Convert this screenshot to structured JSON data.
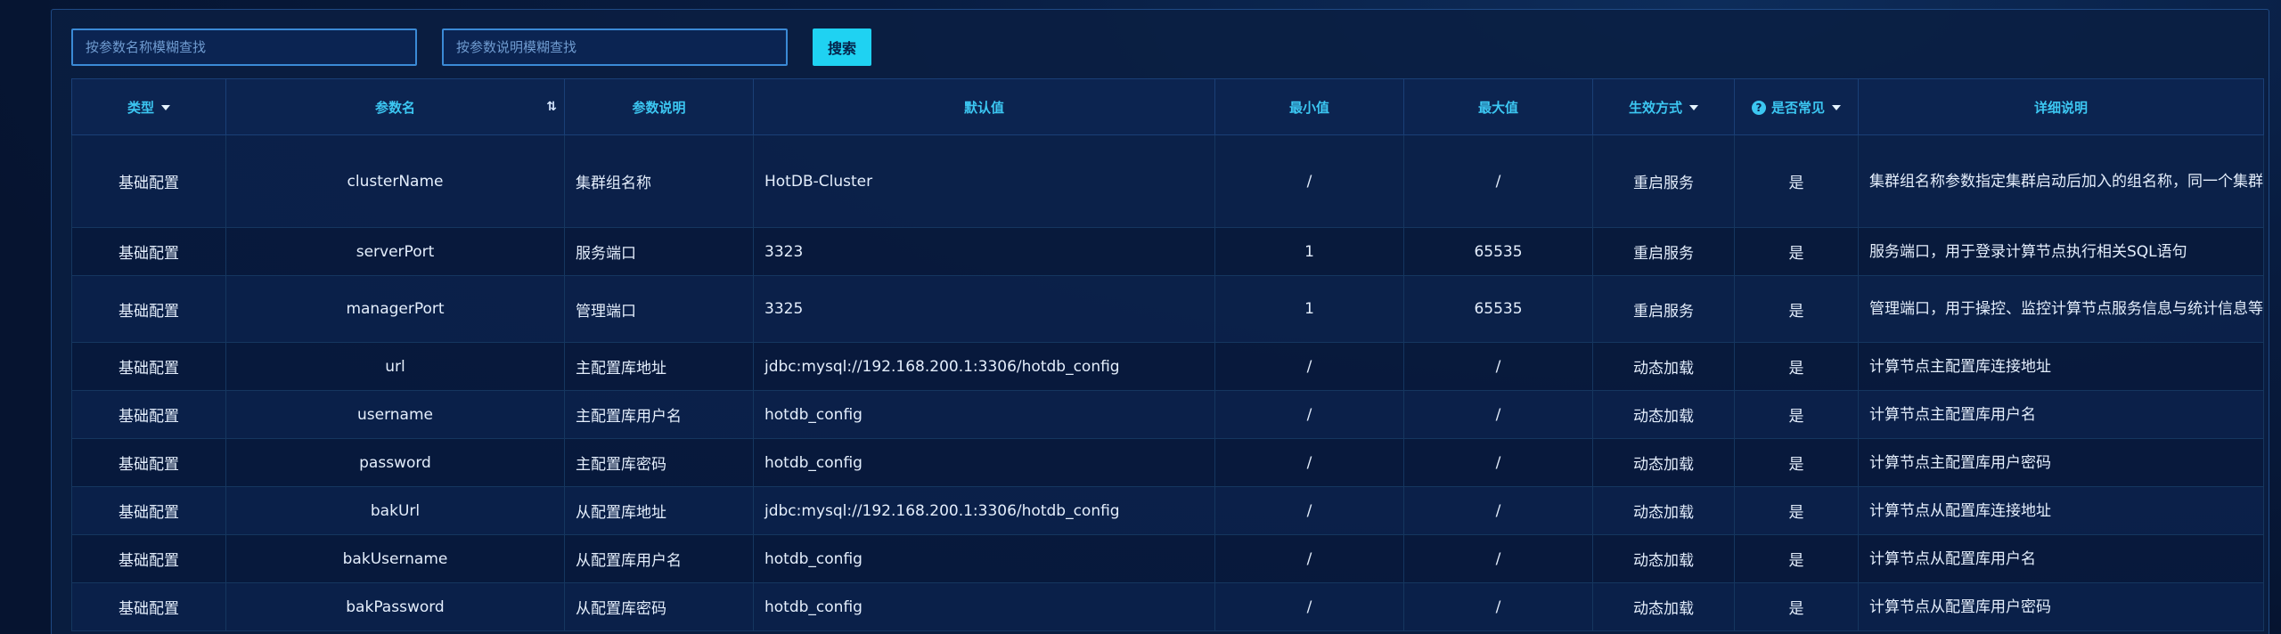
{
  "search": {
    "name_placeholder": "按参数名称模糊查找",
    "desc_placeholder": "按参数说明模糊查找",
    "button_label": "搜索"
  },
  "table": {
    "headers": {
      "type": "类型",
      "param_name": "参数名",
      "param_desc": "参数说明",
      "default": "默认值",
      "min": "最小值",
      "max": "最大值",
      "effect": "生效方式",
      "common": "是否常见",
      "detail": "详细说明"
    },
    "rows": [
      {
        "type": "基础配置",
        "name": "clusterName",
        "desc": "集群组名称",
        "default": "HotDB-Cluster",
        "min": "/",
        "max": "/",
        "effect": "重启服务",
        "common": "是",
        "detail": "集群组名称参数指定集群启动后加入的组名称，同一个集群组内的计算节点的该参数需设置相同，不同集群的计算节点的该参数必须设置不同"
      },
      {
        "type": "基础配置",
        "name": "serverPort",
        "desc": "服务端口",
        "default": "3323",
        "min": "1",
        "max": "65535",
        "effect": "重启服务",
        "common": "是",
        "detail": "服务端口，用于登录计算节点执行相关SQL语句"
      },
      {
        "type": "基础配置",
        "name": "managerPort",
        "desc": "管理端口",
        "default": "3325",
        "min": "1",
        "max": "65535",
        "effect": "重启服务",
        "common": "是",
        "detail": "管理端口，用于操控、监控计算节点服务信息与统计信息等"
      },
      {
        "type": "基础配置",
        "name": "url",
        "desc": "主配置库地址",
        "default": "jdbc:mysql://192.168.200.1:3306/hotdb_config",
        "min": "/",
        "max": "/",
        "effect": "动态加载",
        "common": "是",
        "detail": "计算节点主配置库连接地址"
      },
      {
        "type": "基础配置",
        "name": "username",
        "desc": "主配置库用户名",
        "default": "hotdb_config",
        "min": "/",
        "max": "/",
        "effect": "动态加载",
        "common": "是",
        "detail": "计算节点主配置库用户名"
      },
      {
        "type": "基础配置",
        "name": "password",
        "desc": "主配置库密码",
        "default": "hotdb_config",
        "min": "/",
        "max": "/",
        "effect": "动态加载",
        "common": "是",
        "detail": "计算节点主配置库用户密码"
      },
      {
        "type": "基础配置",
        "name": "bakUrl",
        "desc": "从配置库地址",
        "default": "jdbc:mysql://192.168.200.1:3306/hotdb_config",
        "min": "/",
        "max": "/",
        "effect": "动态加载",
        "common": "是",
        "detail": "计算节点从配置库连接地址"
      },
      {
        "type": "基础配置",
        "name": "bakUsername",
        "desc": "从配置库用户名",
        "default": "hotdb_config",
        "min": "/",
        "max": "/",
        "effect": "动态加载",
        "common": "是",
        "detail": "计算节点从配置库用户名"
      },
      {
        "type": "基础配置",
        "name": "bakPassword",
        "desc": "从配置库密码",
        "default": "hotdb_config",
        "min": "/",
        "max": "/",
        "effect": "动态加载",
        "common": "是",
        "detail": "计算节点从配置库用户密码"
      }
    ]
  }
}
